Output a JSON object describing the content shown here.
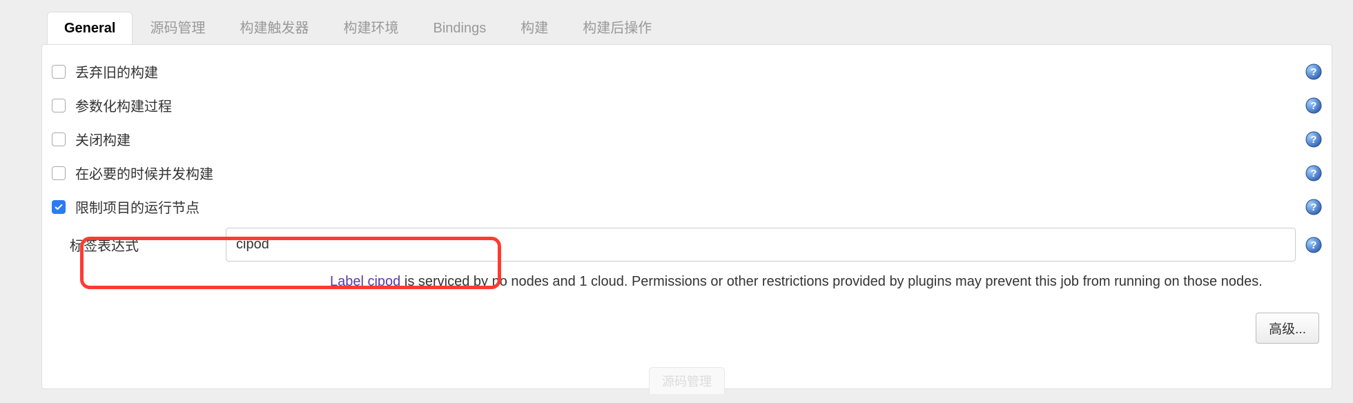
{
  "tabs": [
    {
      "label": "General",
      "active": true
    },
    {
      "label": "源码管理",
      "active": false
    },
    {
      "label": "构建触发器",
      "active": false
    },
    {
      "label": "构建环境",
      "active": false
    },
    {
      "label": "Bindings",
      "active": false
    },
    {
      "label": "构建",
      "active": false
    },
    {
      "label": "构建后操作",
      "active": false
    }
  ],
  "options": [
    {
      "label": "丢弃旧的构建",
      "checked": false
    },
    {
      "label": "参数化构建过程",
      "checked": false
    },
    {
      "label": "关闭构建",
      "checked": false
    },
    {
      "label": "在必要的时候并发构建",
      "checked": false
    },
    {
      "label": "限制项目的运行节点",
      "checked": true
    }
  ],
  "labelExpr": {
    "label": "标签表达式",
    "value": "cipod"
  },
  "hint": {
    "link_text": "Label cipod",
    "rest": " is serviced by no nodes and 1 cloud. Permissions or other restrictions provided by plugins may prevent this job from running on those nodes."
  },
  "advanced_button": "高级...",
  "bottom_ghost": "源码管理"
}
